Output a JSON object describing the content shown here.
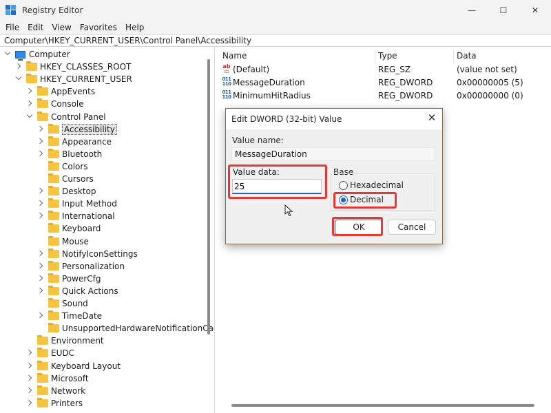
{
  "window": {
    "title": "Registry Editor",
    "minimize_glyph": "—",
    "maximize_glyph": "☐",
    "close_glyph": "✕"
  },
  "menu": [
    "File",
    "Edit",
    "View",
    "Favorites",
    "Help"
  ],
  "address": "Computer\\HKEY_CURRENT_USER\\Control Panel\\Accessibility",
  "tree": [
    {
      "label": "Computer",
      "level": 0,
      "expander": "down",
      "icon": "computer"
    },
    {
      "label": "HKEY_CLASSES_ROOT",
      "level": 1,
      "expander": "right"
    },
    {
      "label": "HKEY_CURRENT_USER",
      "level": 1,
      "expander": "down"
    },
    {
      "label": "AppEvents",
      "level": 2,
      "expander": "right"
    },
    {
      "label": "Console",
      "level": 2,
      "expander": "right"
    },
    {
      "label": "Control Panel",
      "level": 2,
      "expander": "down"
    },
    {
      "label": "Accessibility",
      "level": 3,
      "expander": "right",
      "selected": true
    },
    {
      "label": "Appearance",
      "level": 3,
      "expander": "right"
    },
    {
      "label": "Bluetooth",
      "level": 3,
      "expander": "right"
    },
    {
      "label": "Colors",
      "level": 3,
      "expander": "none"
    },
    {
      "label": "Cursors",
      "level": 3,
      "expander": "none"
    },
    {
      "label": "Desktop",
      "level": 3,
      "expander": "right"
    },
    {
      "label": "Input Method",
      "level": 3,
      "expander": "right"
    },
    {
      "label": "International",
      "level": 3,
      "expander": "right"
    },
    {
      "label": "Keyboard",
      "level": 3,
      "expander": "none"
    },
    {
      "label": "Mouse",
      "level": 3,
      "expander": "none"
    },
    {
      "label": "NotifyIconSettings",
      "level": 3,
      "expander": "right"
    },
    {
      "label": "Personalization",
      "level": 3,
      "expander": "right"
    },
    {
      "label": "PowerCfg",
      "level": 3,
      "expander": "right"
    },
    {
      "label": "Quick Actions",
      "level": 3,
      "expander": "right"
    },
    {
      "label": "Sound",
      "level": 3,
      "expander": "none"
    },
    {
      "label": "TimeDate",
      "level": 3,
      "expander": "right"
    },
    {
      "label": "UnsupportedHardwareNotificationCache",
      "level": 3,
      "expander": "none"
    },
    {
      "label": "Environment",
      "level": 2,
      "expander": "none"
    },
    {
      "label": "EUDC",
      "level": 2,
      "expander": "right"
    },
    {
      "label": "Keyboard Layout",
      "level": 2,
      "expander": "right"
    },
    {
      "label": "Microsoft",
      "level": 2,
      "expander": "right"
    },
    {
      "label": "Network",
      "level": 2,
      "expander": "right"
    },
    {
      "label": "Printers",
      "level": 2,
      "expander": "right"
    }
  ],
  "list": {
    "columns": [
      "Name",
      "Type",
      "Data"
    ],
    "rows": [
      {
        "icon": "string",
        "name": "(Default)",
        "type": "REG_SZ",
        "data": "(value not set)"
      },
      {
        "icon": "binary",
        "name": "MessageDuration",
        "type": "REG_DWORD",
        "data": "0x00000005 (5)"
      },
      {
        "icon": "binary",
        "name": "MinimumHitRadius",
        "type": "REG_DWORD",
        "data": "0x00000000 (0)"
      }
    ]
  },
  "dialog": {
    "title": "Edit DWORD (32-bit) Value",
    "close_glyph": "✕",
    "value_name_label": "Value name:",
    "value_name": "MessageDuration",
    "value_data_label": "Value data:",
    "value_data": "25",
    "base_label": "Base",
    "hex_label": "Hexadecimal",
    "dec_label": "Decimal",
    "selected_base": "Decimal",
    "ok_label": "OK",
    "cancel_label": "Cancel"
  },
  "accent_colors": {
    "highlight": "#e53935",
    "selection_blue": "#1f5fbf",
    "folder": "#f5c542"
  }
}
